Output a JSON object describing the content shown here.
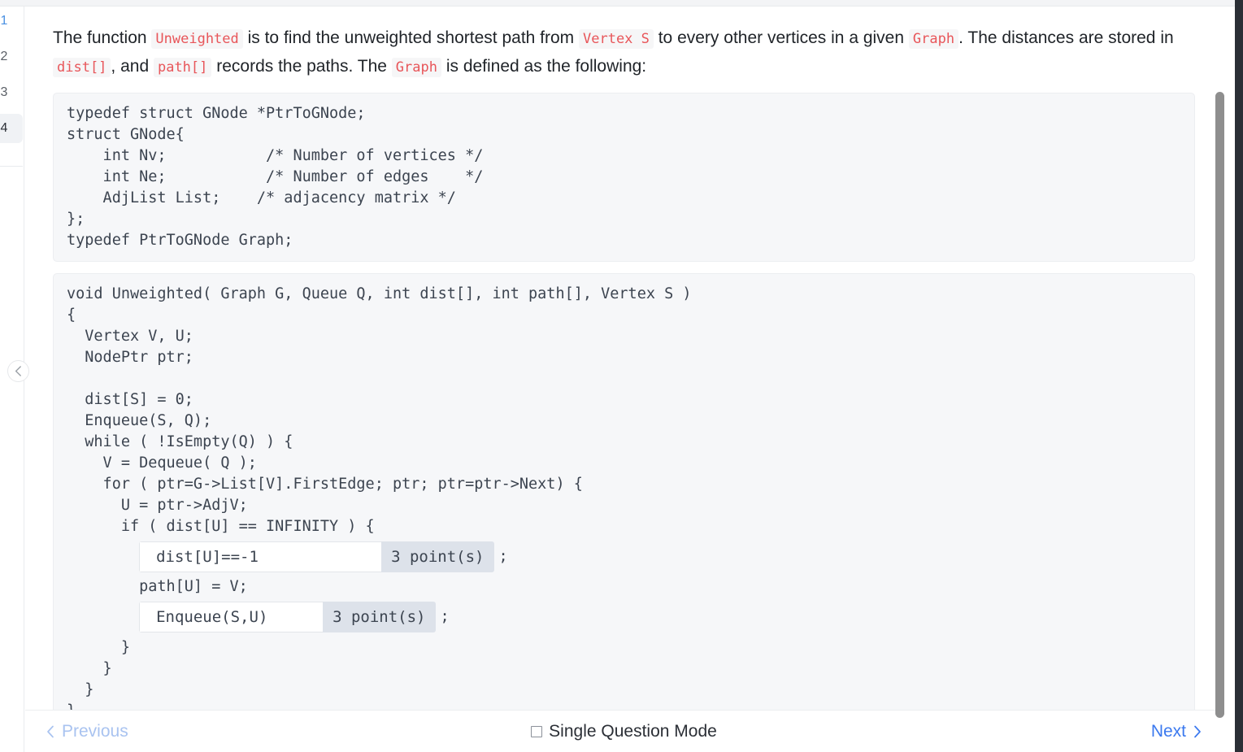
{
  "sidebar": {
    "items": [
      {
        "label": "1",
        "state": "accent"
      },
      {
        "label": "2",
        "state": "normal"
      },
      {
        "label": "3",
        "state": "normal"
      },
      {
        "label": "4",
        "state": "current"
      }
    ],
    "collapse_icon": "chevron-left"
  },
  "prompt": {
    "seg1": "The function ",
    "code1": "Unweighted",
    "seg2": " is to find the unweighted shortest path from ",
    "code2": "Vertex S",
    "seg3": " to every other vertices in a given ",
    "code3": "Graph",
    "seg4": ". The distances are stored in ",
    "code4": "dist[]",
    "seg5": ", and ",
    "code5": "path[]",
    "seg6": " records the paths. The ",
    "code6": "Graph",
    "seg7": " is defined as the following:"
  },
  "struct_code": "typedef struct GNode *PtrToGNode;\nstruct GNode{\n    int Nv;           /* Number of vertices */\n    int Ne;           /* Number of edges    */\n    AdjList List;    /* adjacency matrix */\n};\ntypedef PtrToGNode Graph;",
  "func_code": {
    "head": "void Unweighted( Graph G, Queue Q, int dist[], int path[], Vertex S )\n{\n  Vertex V, U;\n  NodePtr ptr;\n\n  dist[S] = 0;\n  Enqueue(S, Q);\n  while ( !IsEmpty(Q) ) {\n    V = Dequeue( Q );\n    for ( ptr=G->List[V].FirstEdge; ptr; ptr=ptr->Next) {\n      U = ptr->AdjV;\n      if ( dist[U] == INFINITY ) {",
    "blank1": {
      "value": "dist[U]==-1",
      "placeholder": "",
      "points": "3 point(s)",
      "suffix": ";"
    },
    "mid": "        path[U] = V;",
    "blank2": {
      "value": "Enqueue(S,U)",
      "placeholder": "",
      "points": "3 point(s)",
      "suffix": ";"
    },
    "tail": "      }\n    }\n  }\n}"
  },
  "footer": {
    "previous_label": "Previous",
    "previous_icon": "chevron-left-icon",
    "next_label": "Next",
    "next_icon": "chevron-right-icon",
    "mode_label": "Single Question Mode",
    "mode_checked": false
  },
  "colors": {
    "inline_code": "#e8565a",
    "next_link": "#3b79ef",
    "prev_link": "#a9c3f0",
    "points_badge_bg": "#dde2ea",
    "code_bg": "#f6f7f9"
  }
}
